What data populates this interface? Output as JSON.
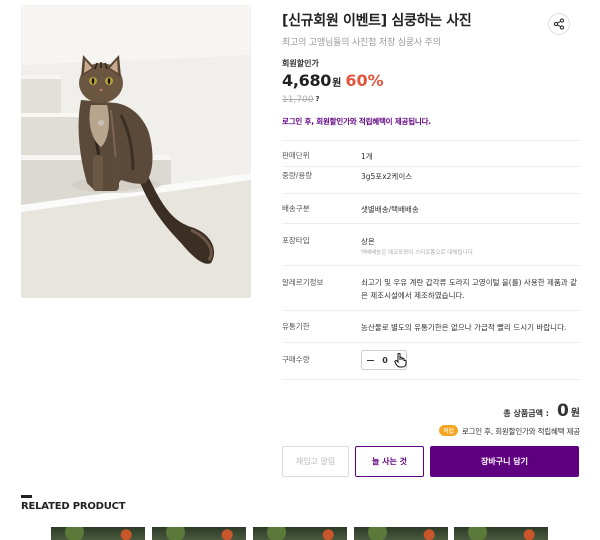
{
  "product": {
    "title": "[신규회원 이벤트] 심쿵하는 사진",
    "subtitle": "최고의 고앵님들의 사진첩 저장 심쿵사 주의",
    "price_label": "회원할인가",
    "price": "4,680",
    "price_unit": "원",
    "discount_rate": "60%",
    "original_price": "11,700",
    "original_price_hint": "?",
    "login_note": "로그인 후, 회원할인가와 적립혜택이 제공됩니다."
  },
  "specs": [
    {
      "key": "판매단위",
      "value": "1개"
    },
    {
      "key": "중량/용량",
      "value": "3g5포x2케이스"
    },
    {
      "key": "배송구분",
      "value": "샛별배송/택배배송"
    },
    {
      "key": "포장타입",
      "value": "상온",
      "sub": "택배배송은 에코포장이 스티로폼으로 대체됩니다."
    },
    {
      "key": "알레르기정보",
      "value": "쇠고기 및 우유 계란 갑각류 도라지 고영이털 을(를) 사용한 제품과 같은 제조시설에서 제조하였습니다."
    },
    {
      "key": "유통기한",
      "value": "농산물로 별도의 유통기한은 없으나 가급적 빨리 드시기 바랍니다."
    },
    {
      "key": "구매수량",
      "value": ""
    }
  ],
  "quantity": {
    "value": "0"
  },
  "total": {
    "label": "총 상품금액 :",
    "amount": "0",
    "unit": "원",
    "accrual_badge": "적립",
    "accrual_text": "로그인 후, 회원할인가와 적립혜택 제공"
  },
  "buttons": {
    "notify": "재입고 알림",
    "always": "늘 사는 것",
    "cart": "장바구니 담기"
  },
  "related": {
    "title": "RELATED PRODUCT"
  },
  "colors": {
    "brand": "#5f0080",
    "discount": "#e5543c",
    "badge": "#f5a524"
  },
  "icons": {
    "share": "share-icon",
    "minus": "minus-icon",
    "cursor": "hand-cursor-icon"
  }
}
